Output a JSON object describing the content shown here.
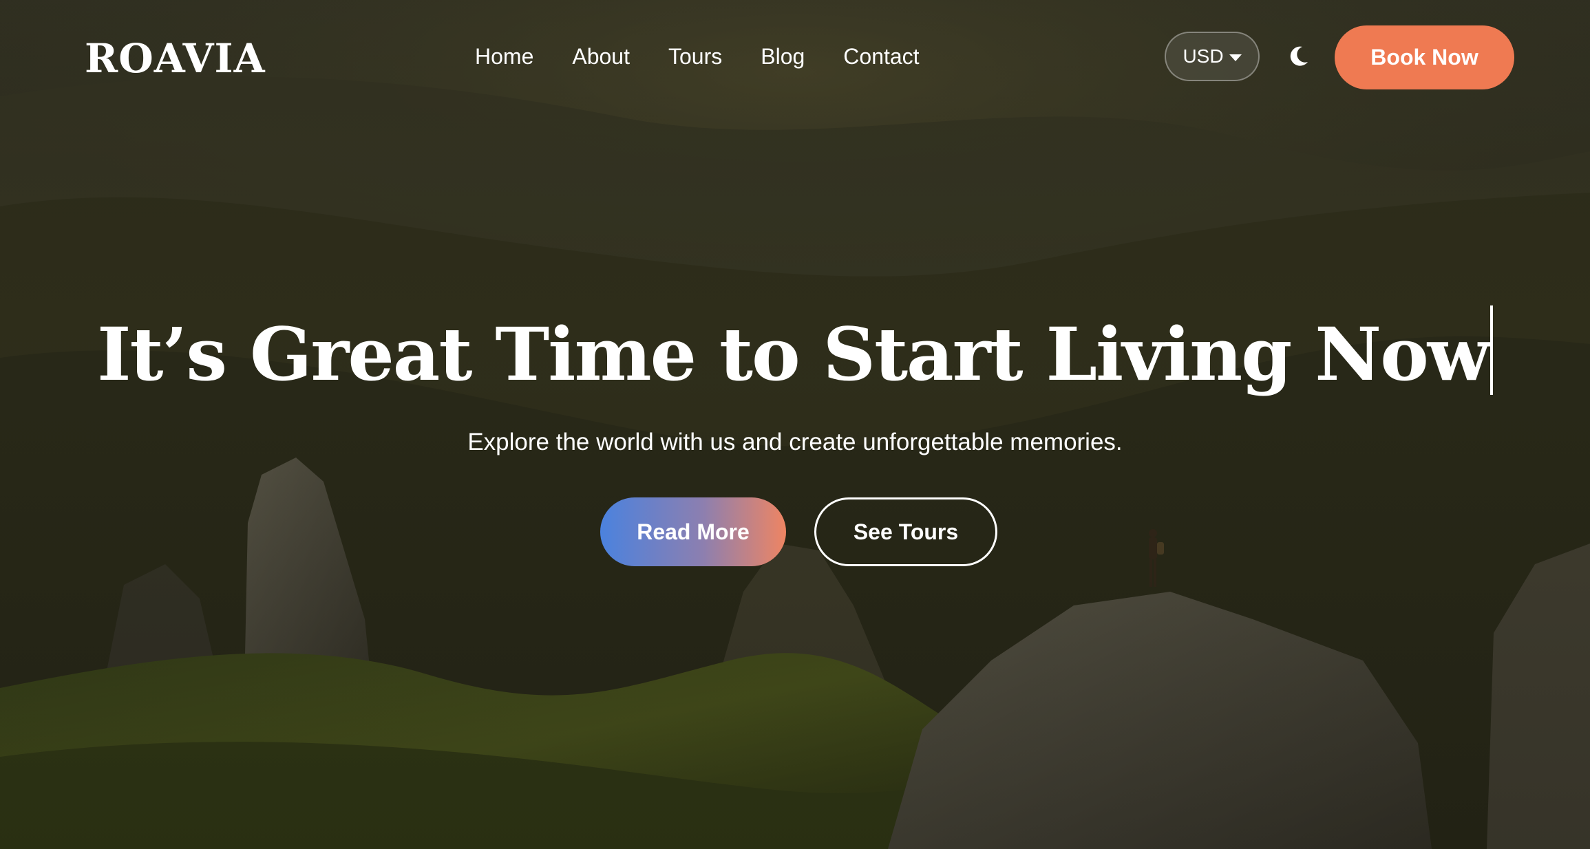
{
  "header": {
    "logo": "ROAVIA",
    "nav": [
      {
        "label": "Home"
      },
      {
        "label": "About"
      },
      {
        "label": "Tours"
      },
      {
        "label": "Blog"
      },
      {
        "label": "Contact"
      }
    ],
    "currency": "USD",
    "theme_icon": "moon-icon",
    "book_label": "Book Now"
  },
  "hero": {
    "headline": "It’s Great Time to Start Living Now",
    "subtitle": "Explore the world with us and create unforgettable memories.",
    "read_more_label": "Read More",
    "see_tours_label": "See Tours"
  },
  "colors": {
    "accent": "#ef7a52",
    "gradient_start": "#4b82de",
    "gradient_end": "#ee8563"
  }
}
